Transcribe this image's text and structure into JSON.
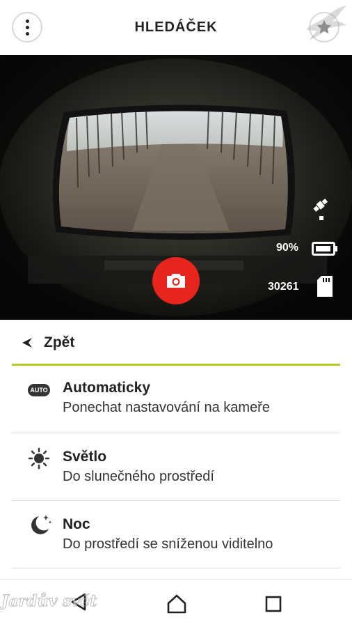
{
  "header": {
    "title": "HLEDÁČEK",
    "menu_icon": "more-vertical-icon",
    "favorite_icon": "star-icon"
  },
  "viewfinder": {
    "battery_percent": "90%",
    "battery_level": 0.8,
    "remaining_shots": "30261",
    "gps_icon": "satellite-icon",
    "battery_icon": "battery-icon",
    "storage_icon": "sd-card-icon",
    "shutter_icon": "camera-icon",
    "shutter_color": "#e8251c"
  },
  "back": {
    "label": "Zpět",
    "icon": "chevron-left-icon"
  },
  "accent_color": "#b5cc1e",
  "modes": [
    {
      "icon": "auto-badge-icon",
      "badge": "AUTO",
      "title": "Automaticky",
      "subtitle": "Ponechat nastavování na kameře"
    },
    {
      "icon": "sun-icon",
      "title": "Světlo",
      "subtitle": "Do slunečného prostředí"
    },
    {
      "icon": "moon-stars-icon",
      "title": "Noc",
      "subtitle": "Do prostředí se sníženou viditelno"
    }
  ],
  "navbar": {
    "back_icon": "nav-back-icon",
    "home_icon": "nav-home-icon",
    "recents_icon": "nav-recents-icon"
  },
  "watermark": {
    "text": "Jardův svět"
  }
}
